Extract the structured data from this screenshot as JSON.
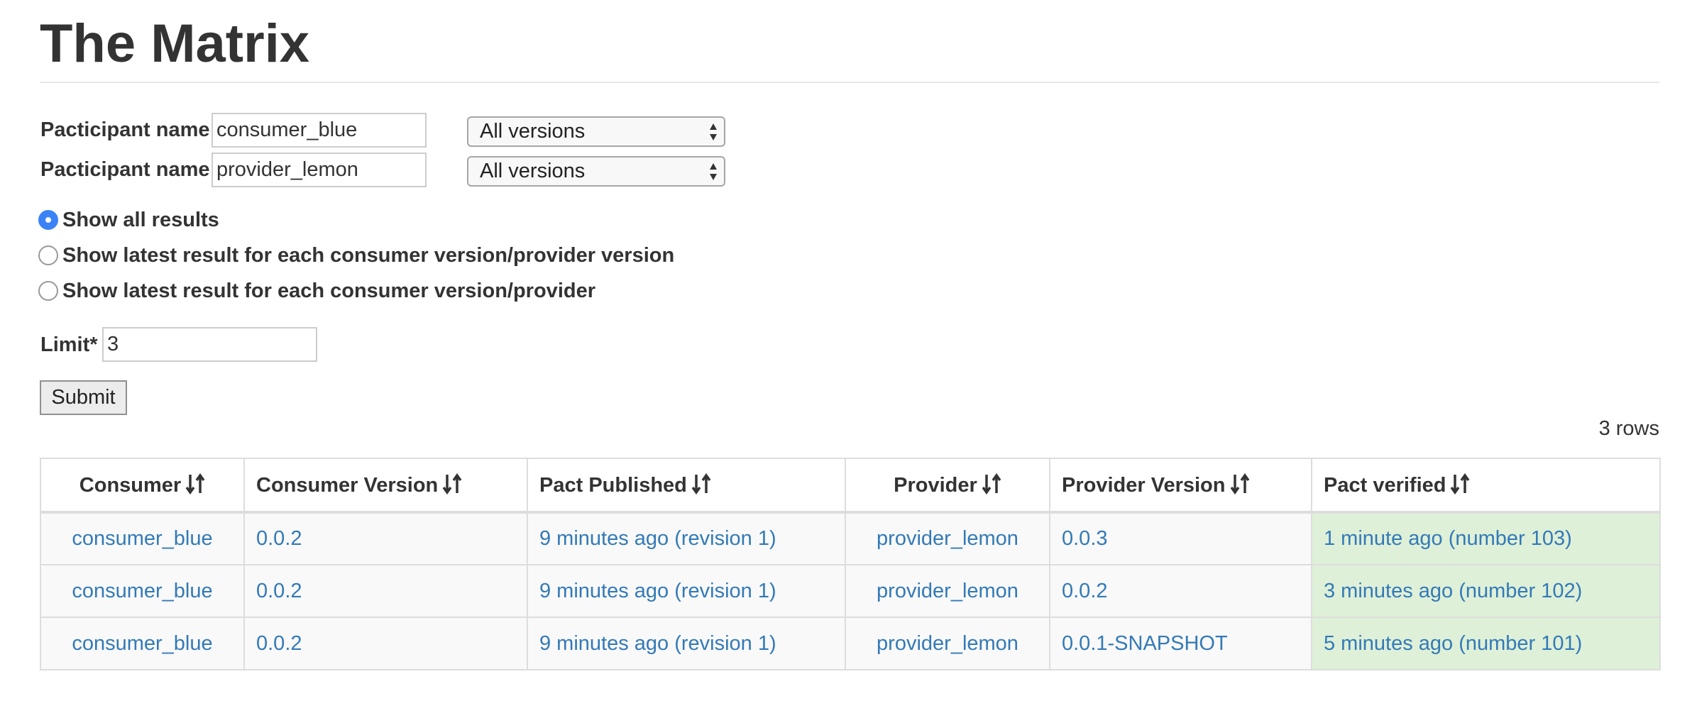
{
  "page": {
    "title": "The Matrix"
  },
  "filters": [
    {
      "label": "Pacticipant name",
      "value": "consumer_blue",
      "version_select": "All versions"
    },
    {
      "label": "Pacticipant name",
      "value": "provider_lemon",
      "version_select": "All versions"
    }
  ],
  "radio_options": [
    {
      "label": "Show all results",
      "checked": true
    },
    {
      "label": "Show latest result for each consumer version/provider version",
      "checked": false
    },
    {
      "label": "Show latest result for each consumer version/provider",
      "checked": false
    }
  ],
  "limit": {
    "label": "Limit*",
    "value": "3"
  },
  "submit_label": "Submit",
  "rows_count": "3 rows",
  "table": {
    "headers": [
      "Consumer",
      "Consumer Version",
      "Pact Published",
      "Provider",
      "Provider Version",
      "Pact verified"
    ],
    "rows": [
      [
        "consumer_blue",
        "0.0.2",
        "9 minutes ago (revision 1)",
        "provider_lemon",
        "0.0.3",
        "1 minute ago (number 103)"
      ],
      [
        "consumer_blue",
        "0.0.2",
        "9 minutes ago (revision 1)",
        "provider_lemon",
        "0.0.2",
        "3 minutes ago (number 102)"
      ],
      [
        "consumer_blue",
        "0.0.2",
        "9 minutes ago (revision 1)",
        "provider_lemon",
        "0.0.1-SNAPSHOT",
        "5 minutes ago (number 101)"
      ]
    ]
  },
  "icons": {
    "sort": "sort-icon",
    "select_arrows": "select-arrows-icon",
    "radio_checked": "radio-checked-icon"
  },
  "colors": {
    "link": "#337ab7",
    "verified_background": "#dff0d8",
    "radio_selected": "#3b82f6",
    "row_background": "#f9f9f9"
  }
}
